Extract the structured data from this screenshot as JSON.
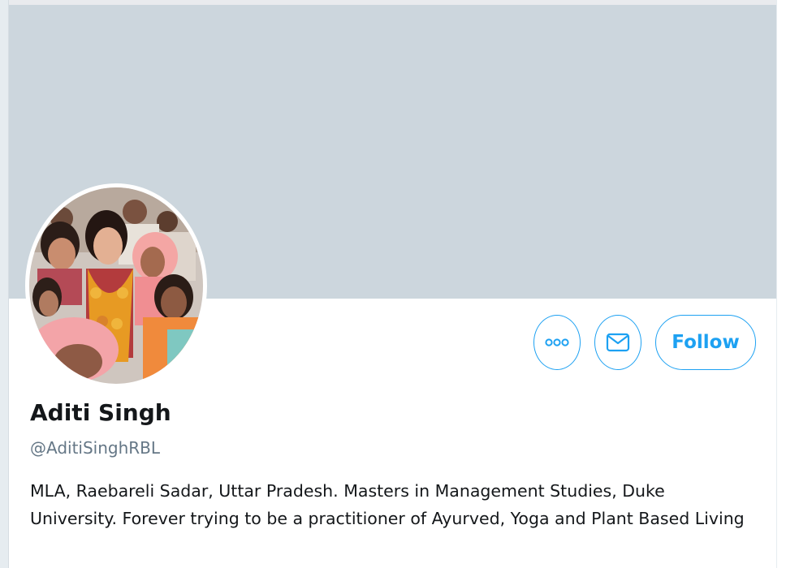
{
  "profile": {
    "name": "Aditi Singh",
    "handle": "@AditiSinghRBL",
    "bio": "MLA, Raebareli Sadar, Uttar Pradesh. Masters in Management Studies, Duke University. Forever trying to be a practitioner of Ayurved, Yoga and Plant Based Living"
  },
  "actions": {
    "more_icon": "more-horizontal-icon",
    "message_icon": "envelope-icon",
    "follow_label": "Follow"
  },
  "colors": {
    "accent": "#1da1f2",
    "banner": "#ccd6dd",
    "text_primary": "#14171a",
    "text_secondary": "#657786"
  }
}
